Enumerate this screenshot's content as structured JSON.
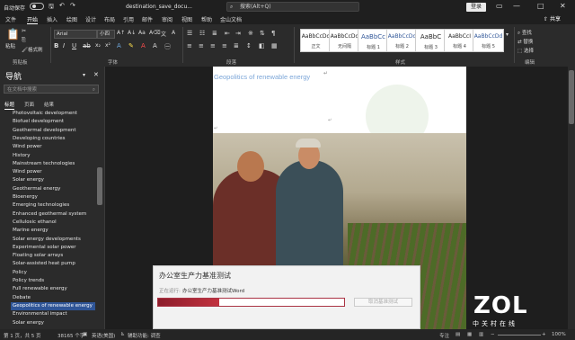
{
  "titlebar": {
    "autosave": "自动保存",
    "filename": "destination_save_docu...",
    "search_placeholder": "搜索(Alt+Q)",
    "signin": "登录",
    "minimize": "—",
    "restore": "□",
    "close": "✕"
  },
  "menu": {
    "tabs": [
      "文件",
      "开始",
      "插入",
      "绘图",
      "设计",
      "布局",
      "引用",
      "邮件",
      "审阅",
      "视图",
      "帮助",
      "金山文档"
    ],
    "active": "开始",
    "share": "共享"
  },
  "ribbon": {
    "paste": "粘贴",
    "format_painter": "格式刷",
    "clipboard_label": "剪贴板",
    "font_name": "Arial",
    "font_size": "小四",
    "font_label": "字体",
    "paragraph_label": "段落",
    "styles_label": "样式",
    "editing_label": "编辑",
    "find": "查找",
    "replace": "替换",
    "select": "选择",
    "styles": [
      {
        "preview": "AaBbCcDd",
        "name": "正文"
      },
      {
        "preview": "AaBbCcDd",
        "name": "无间隔"
      },
      {
        "preview": "AaBbCc",
        "name": "标题 1"
      },
      {
        "preview": "AaBbCcDd",
        "name": "标题 2"
      },
      {
        "preview": "AaBbC",
        "name": "标题 3"
      },
      {
        "preview": "AaBbCcI",
        "name": "标题 4"
      },
      {
        "preview": "AaBbCcDd",
        "name": "标题 5"
      }
    ]
  },
  "nav": {
    "title": "导航",
    "close": "✕",
    "search_placeholder": "在文档中搜索",
    "tabs": [
      "标题",
      "页面",
      "结果"
    ],
    "active_tab": "标题",
    "items": [
      "Photovoltaic development",
      "Biofuel development",
      "Geothermal development",
      "Developing countries",
      "Wind power",
      "History",
      "Mainstream technologies",
      "Wind power",
      "Solar energy",
      "Geothermal energy",
      "Bioenergy",
      "Emerging technologies",
      "Enhanced geothermal system",
      "Cellulosic ethanol",
      "Marine energy",
      "Solar energy developments",
      "Experimental solar power",
      "Floating solar arrays",
      "Solar-assisted heat pump",
      "Policy",
      "Policy trends",
      "Full renewable energy",
      "Debate",
      "Geopolitics of renewable energy",
      "Environmental impact",
      "Solar energy"
    ],
    "selected": "Geopolitics of renewable energy"
  },
  "document": {
    "heading": "Geopolitics of renewable energy",
    "para_mark": "↵"
  },
  "dialog": {
    "title": "办公室生产力基准测试",
    "label": "正在运行:",
    "value": "办公室生产力基准测试Word",
    "progress": 0.33,
    "button": "取消基准测试"
  },
  "statusbar": {
    "page": "第 1 页，共 5 页",
    "words": "38165 个字",
    "language": "英语(美国)",
    "accessibility": "辅助功能: 调查",
    "focus": "专注",
    "zoom": "100%"
  },
  "watermark": {
    "logo": "ZOL",
    "sub": "中关村在线"
  }
}
